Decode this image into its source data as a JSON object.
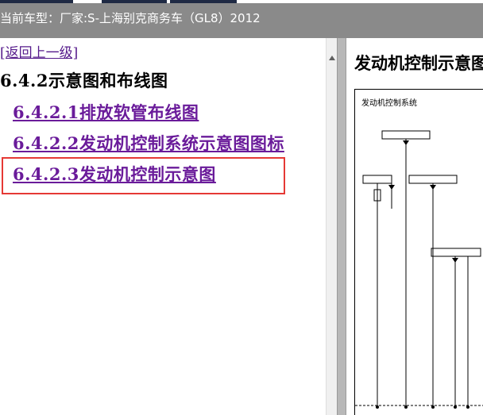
{
  "header": {
    "vehicle_label": "当前车型：厂家:S-上海别克商务车（GL8）2012"
  },
  "left_pane": {
    "back_link": "[返回上一级]",
    "section_title": "6.4.2示意图和布线图",
    "toc": [
      {
        "label": "6.4.2.1排放软管布线图"
      },
      {
        "label": "6.4.2.2发动机控制系统示意图图标"
      },
      {
        "label": "6.4.2.3发动机控制示意图",
        "highlighted": true
      }
    ]
  },
  "right_pane": {
    "title": "发动机控制示意图",
    "diagram_header": "发动机控制系统"
  },
  "colors": {
    "header_bg": "#8a8a8a",
    "link_color": "#6a1b9a",
    "highlight_border": "#e53935",
    "splitter": "#b8b8b8"
  },
  "icons": {
    "scroll_up": "triangle-up-icon"
  }
}
